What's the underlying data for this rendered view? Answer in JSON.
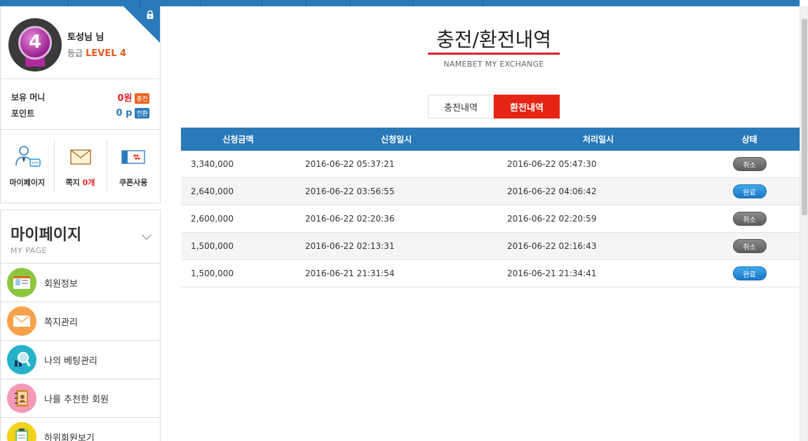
{
  "profile": {
    "level_number": "4",
    "username": "토성님 님",
    "grade_label": "등급",
    "grade_value": "LEVEL 4"
  },
  "wallet": {
    "money_label": "보유 머니",
    "money_value": "0원",
    "money_action": "충전",
    "point_label": "포인트",
    "point_value": "0 p",
    "point_action": "전환"
  },
  "quick": {
    "mypage_label": "마이페이지",
    "message_label": "쪽지",
    "message_count": "0개",
    "coupon_label": "쿠폰사용"
  },
  "mypage": {
    "title": "마이페이지",
    "subtitle": "MY PAGE",
    "items": [
      {
        "label": "회원정보",
        "color": "#8cc63f"
      },
      {
        "label": "쪽지관리",
        "color": "#f7a24a"
      },
      {
        "label": "나의 베팅관리",
        "color": "#26b3c9"
      },
      {
        "label": "나를 추천한 회원",
        "color": "#f49ab8"
      },
      {
        "label": "하위회원보기",
        "color": "#f2d21b"
      }
    ]
  },
  "main": {
    "title": "충전/환전내역",
    "subtitle": "NAMEBET MY EXCHANGE",
    "tabs": [
      {
        "label": "충전내역",
        "active": false
      },
      {
        "label": "환전내역",
        "active": true
      }
    ]
  },
  "table": {
    "headers": [
      "신청금액",
      "신청일시",
      "처리일시",
      "상태"
    ],
    "rows": [
      {
        "amount": "3,340,000",
        "requested": "2016-06-22 05:37:21",
        "processed": "2016-06-22 05:47:30",
        "status": "취소",
        "status_color": "#666666"
      },
      {
        "amount": "2,640,000",
        "requested": "2016-06-22 03:56:55",
        "processed": "2016-06-22 04:06:42",
        "status": "완료",
        "status_color": "#1c78c8"
      },
      {
        "amount": "2,600,000",
        "requested": "2016-06-22 02:20:36",
        "processed": "2016-06-22 02:20:59",
        "status": "취소",
        "status_color": "#666666"
      },
      {
        "amount": "1,500,000",
        "requested": "2016-06-22 02:13:31",
        "processed": "2016-06-22 02:16:43",
        "status": "취소",
        "status_color": "#666666"
      },
      {
        "amount": "1,500,000",
        "requested": "2016-06-21 21:31:54",
        "processed": "2016-06-21 21:34:41",
        "status": "완료",
        "status_color": "#1c78c8"
      }
    ]
  },
  "colors": {
    "brand_blue": "#2a7ab9",
    "accent_red": "#e52413",
    "level_orange": "#e55a1f"
  }
}
